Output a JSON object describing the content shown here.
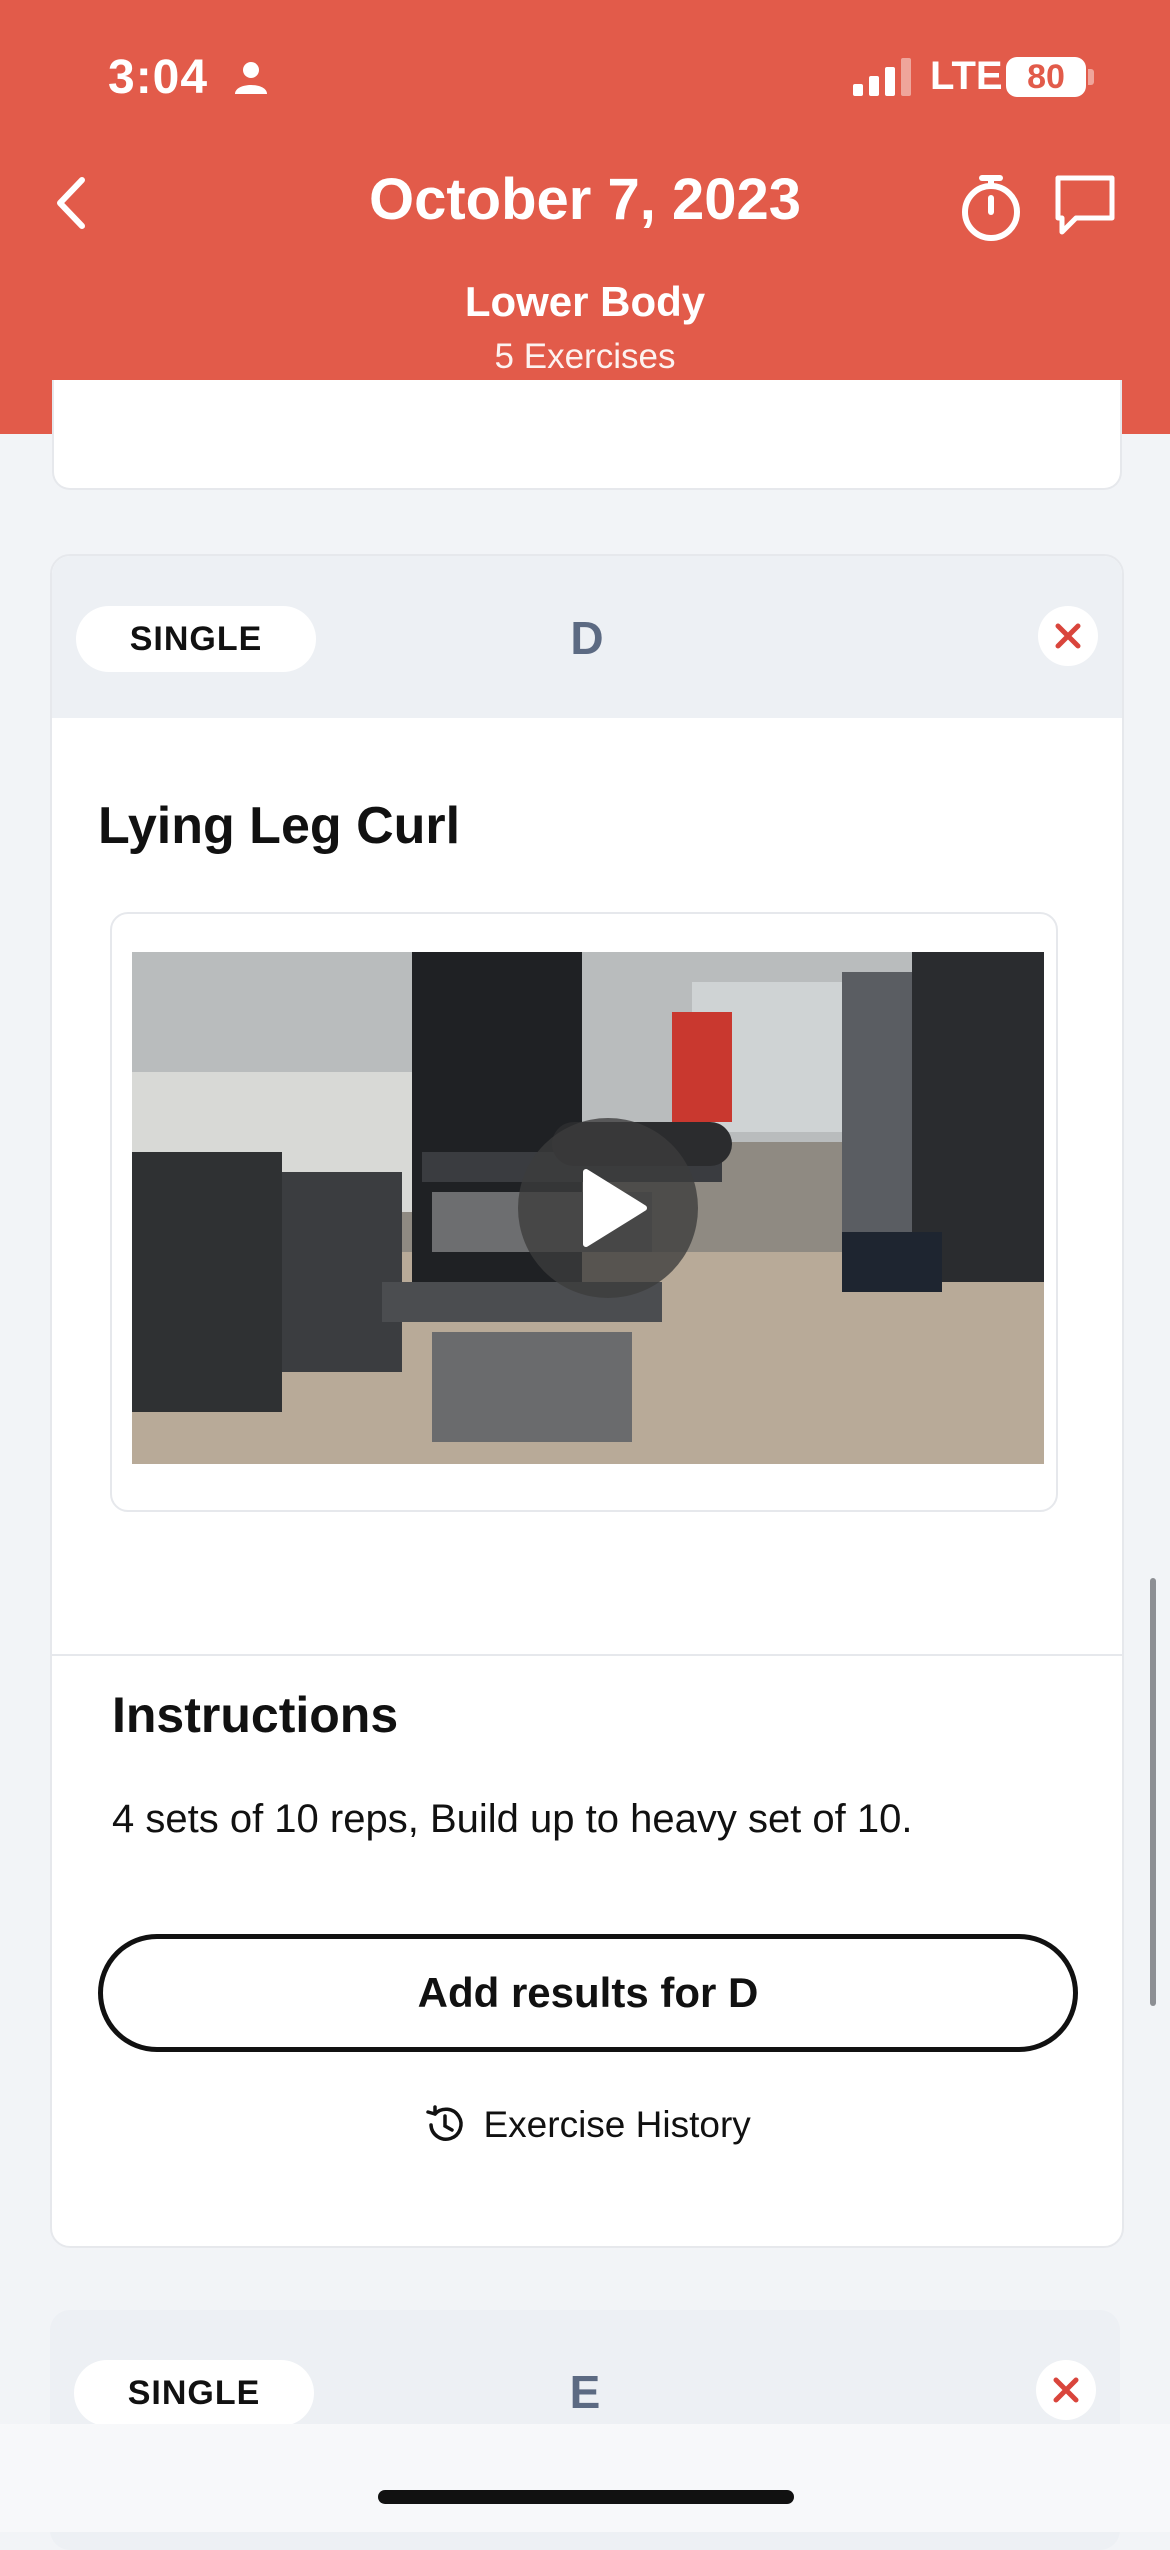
{
  "status_bar": {
    "time": "3:04",
    "network": "LTE",
    "battery": "80"
  },
  "header": {
    "title": "October 7, 2023",
    "workout_name": "Lower Body",
    "exercise_count": "5 Exercises",
    "color": "#e25b4a"
  },
  "exercise_card": {
    "type_label": "SINGLE",
    "letter": "D",
    "exercise_name": "Lying Leg Curl",
    "instructions_heading": "Instructions",
    "instructions_text": "4 sets of 10 reps, Build up to heavy set of 10.",
    "add_results_label": "Add results for D",
    "history_label": "Exercise History"
  },
  "next_card": {
    "type_label": "SINGLE",
    "letter": "E"
  },
  "icons": [
    "back-icon",
    "timer-icon",
    "chat-icon",
    "close-icon",
    "play-icon",
    "history-icon",
    "person-icon",
    "signal-icon"
  ]
}
